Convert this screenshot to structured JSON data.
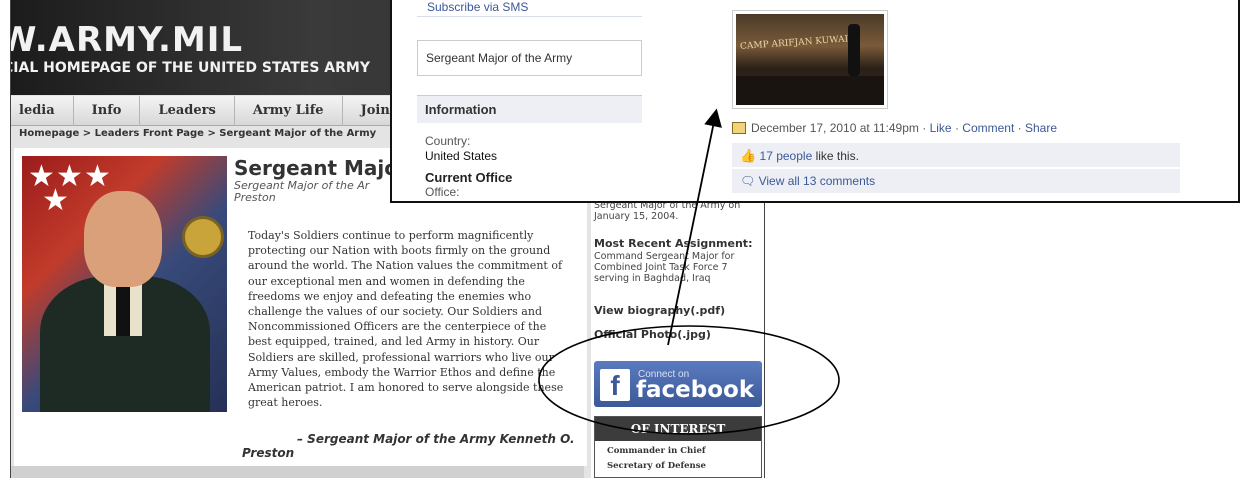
{
  "army_site": {
    "logo": "W.ARMY.MIL",
    "subtitle": "CIAL HOMEPAGE OF THE UNITED STATES ARMY",
    "nav": [
      "ledia",
      "Info",
      "Leaders",
      "Army Life",
      "Join"
    ],
    "breadcrumb": "Homepage > Leaders Front Page > Sergeant Major of the Army",
    "title": "Sergeant Major",
    "subtitle_line": "Sergeant Major of the Ar",
    "subtitle_name": "Preston",
    "quote": "Today's Soldiers continue to perform magnificently protecting our Nation with boots firmly on the ground around the world. The Nation values the commitment of our exceptional men and women in defending the freedoms we enjoy and defeating the enemies who challenge the values of our society. Our Soldiers and Noncommissioned Officers are the centerpiece of the best equipped, trained, and led Army in history. Our Soldiers are skilled, professional warriors who live our Army Values, embody the Warrior Ethos and define the American patriot. I am honored to serve alongside these great heroes.",
    "signature": "– Sergeant Major of the Army Kenneth O. Preston",
    "sidebar": {
      "partial_line": "Sergeant Major of the Army on",
      "date": "January 15, 2004.",
      "recent_heading": "Most Recent Assignment:",
      "recent_text": "Command Sergeant Major for Combined Joint Task Force 7 serving in Baghdad, Iraq",
      "bio_link": "View biography(.pdf)",
      "photo_link": "Official Photo(.jpg)",
      "fb_connect_on": "Connect on",
      "fb_logo_letter": "f",
      "fb_word": "facebook",
      "interest_heading": "OF INTEREST",
      "interest_links": [
        "Commander in Chief",
        "Secretary of Defense"
      ]
    }
  },
  "facebook_page": {
    "sms_link": "Subscribe via SMS",
    "page_name": "Sergeant Major of the Army",
    "info_heading": "Information",
    "country_label": "Country:",
    "country_value": "United States",
    "current_office_heading": "Current Office",
    "office_label": "Office:",
    "photo_banner": "CAMP ARIFJAN KUWAIT",
    "post_date": "December 17, 2010 at 11:49pm",
    "post_actions": [
      "Like",
      "Comment",
      "Share"
    ],
    "likes_link": "17 people",
    "likes_text": " like this.",
    "comments_link": "View all 13 comments"
  },
  "colors": {
    "facebook_blue": "#3b5998",
    "facebook_panel": "#edeff4",
    "army_banner": "#2a2a2a"
  }
}
